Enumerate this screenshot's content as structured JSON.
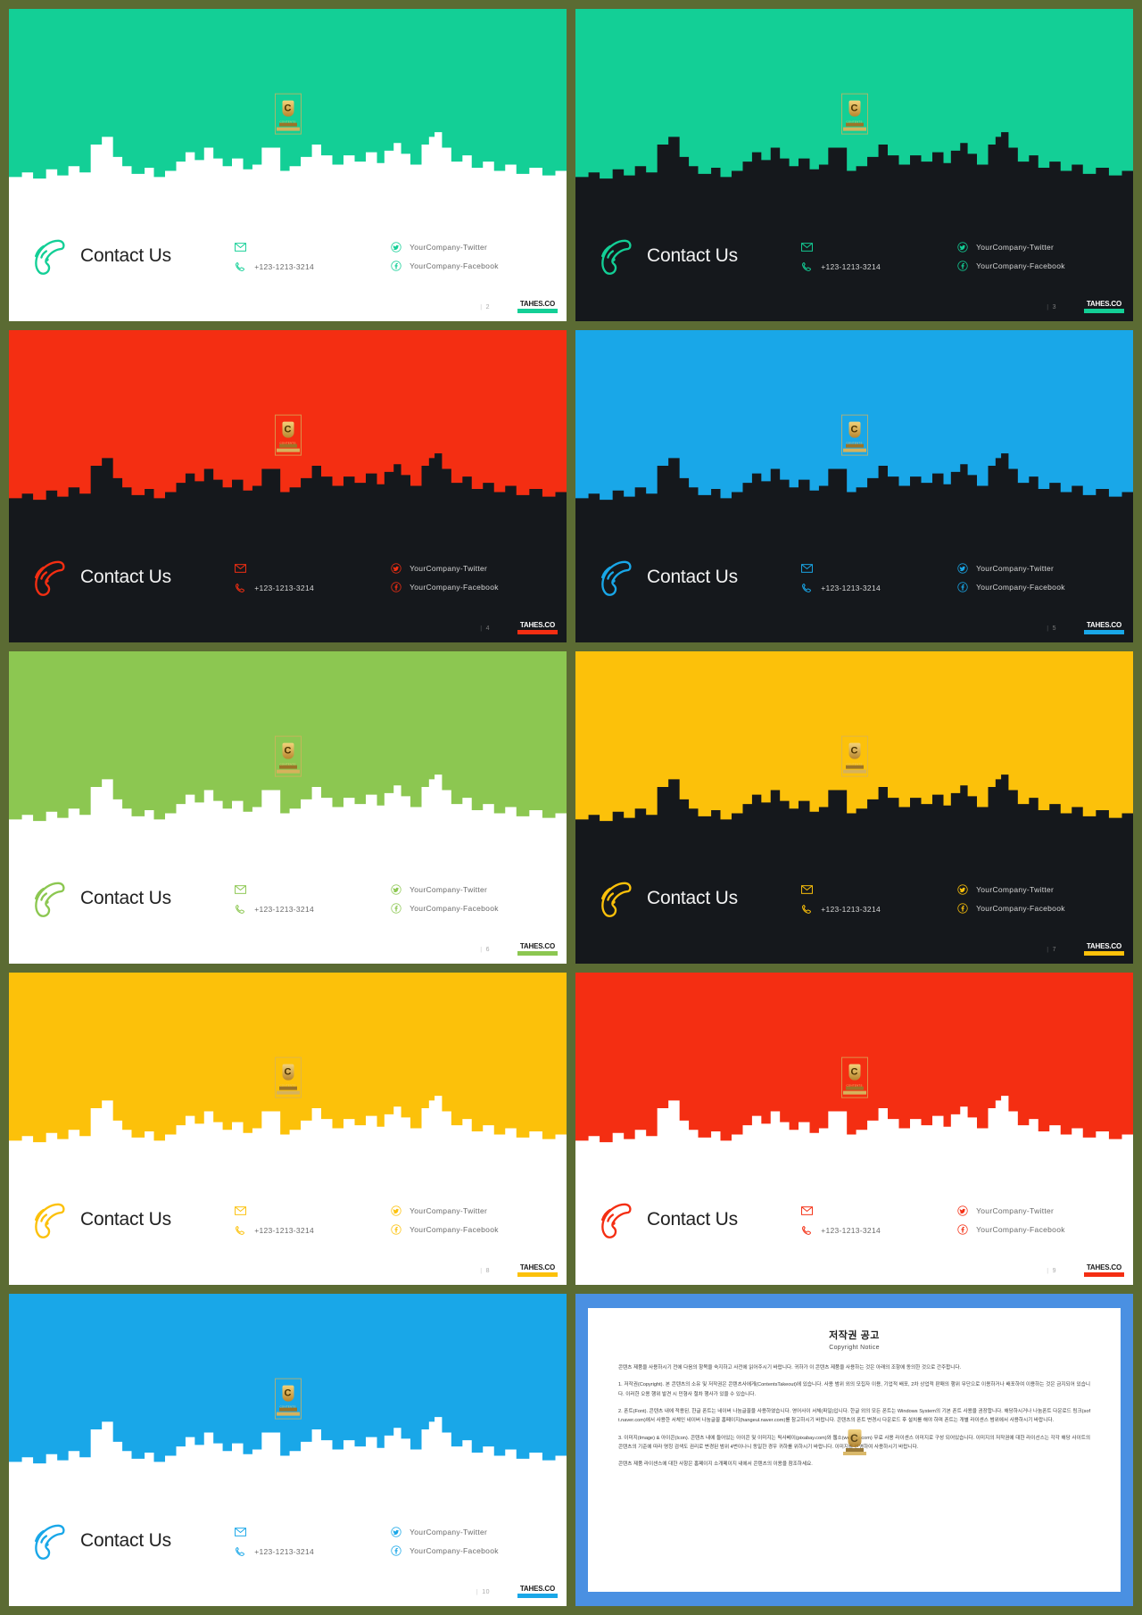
{
  "deck": {
    "background_color": "#5b6b33",
    "contact_title": "Contact Us",
    "phone": "+123-1213-3214",
    "twitter": "YourCompany-Twitter",
    "facebook": "YourCompany-Facebook",
    "brand_badge": "TAHES.CO",
    "trophy_label": "CONTENTS"
  },
  "slides": [
    {
      "page": "2",
      "sky_color": "#13cf96",
      "band": "light",
      "accent": "#13cf96",
      "skyline_color": "#ffffff",
      "skyline_style": "cutout"
    },
    {
      "page": "3",
      "sky_color": "#13cf96",
      "band": "dark",
      "accent": "#13cf96",
      "skyline_color": "#15181c",
      "skyline_style": "solid"
    },
    {
      "page": "4",
      "sky_color": "#f42e12",
      "band": "dark",
      "accent": "#f42e12",
      "skyline_color": "#15181c",
      "skyline_style": "solid"
    },
    {
      "page": "5",
      "sky_color": "#19a7e8",
      "band": "dark",
      "accent": "#19a7e8",
      "skyline_color": "#15181c",
      "skyline_style": "solid"
    },
    {
      "page": "6",
      "sky_color": "#8cc751",
      "band": "light",
      "accent": "#8cc751",
      "skyline_color": "#ffffff",
      "skyline_style": "cutout"
    },
    {
      "page": "7",
      "sky_color": "#fcc10a",
      "band": "dark",
      "accent": "#fcc10a",
      "skyline_color": "#15181c",
      "skyline_style": "solid"
    },
    {
      "page": "8",
      "sky_color": "#fcc10a",
      "band": "light",
      "accent": "#fcc10a",
      "skyline_color": "#ffffff",
      "skyline_style": "cutout"
    },
    {
      "page": "9",
      "sky_color": "#f42e12",
      "band": "light",
      "accent": "#f42e12",
      "skyline_color": "#ffffff",
      "skyline_style": "cutout"
    },
    {
      "page": "10",
      "sky_color": "#19a7e8",
      "band": "light",
      "accent": "#19a7e8",
      "skyline_color": "#ffffff",
      "skyline_style": "cutout"
    }
  ],
  "copyright_slide": {
    "background_color": "#4a90e2",
    "title_ko": "저작권 공고",
    "title_en": "Copyright Notice",
    "intro": "콘텐츠 제품을 사용하시기 전에 다음의 항목을 숙지하고 사전에 읽어주시기 바랍니다. 귀하가 이 콘텐츠 제품을 사용하는 것은 아래의 조항에 동의한 것으로 간주합니다.",
    "p1": "1. 저작권(Copyright). 본 콘텐츠의 소유 및 저작권은 콘텐츠사에게(ContentsTakeout)에 있습니다. 사용 범위 외의 모집자 이용, 기업적 배포, 2차 상업적 판매의 행위 무단으로 이용하거나 배포하여 이용하는 것은 금지되어 있습니다. 이러한 오용 행위 발견 시 민형사 절차 행사가 있을 수 있습니다.",
    "p2": "2. 폰트(Font). 콘텐츠 내에 적용된, 한글 폰트는 네이버 나눔글꼴을 사용하였습니다. 영어사이 서체(파일)입니다. 한글 외의 모든 폰트는 Windows System의 기본 폰트 사용을 권장합니다. 해당하시거나 나눔폰트 다운로드 링크(soft.naver.com)에서 사용한 서체인 네이버 나눔글꼴 홈페이지(hangeul.naver.com)를 참고하시기 바랍니다. 콘텐츠의 폰트 변경시 다운로드 후 설치를 해야 하며 폰트는 개별 라이센스 범위에서 사용하시기 바랍니다.",
    "p3": "3. 이미지(Image) & 아이콘(Icon). 콘텐츠 내에 들어있는 아이콘 및 이미지는 픽사베이(pixabay.com)와 웹소(websvy.com) 무료 사용 라이센스 이미지로 구성 되어있습니다. 이미지의 저작권에 대한 라이선스는 각각 해당 사이트의 콘텐츠의 기준에 따라 명칭 검색도 권리로 변경된 범위 4번이나니 동일한 경우 귀하를 위하시기 바랍니다. 이미지를 반영하여 사용하시기 바랍니다.",
    "footer": "콘텐츠 제품 라이센스에 대한 사항은 홈페이지 소개페이지 내에서 콘텐츠의 이용을 참조하세요."
  }
}
